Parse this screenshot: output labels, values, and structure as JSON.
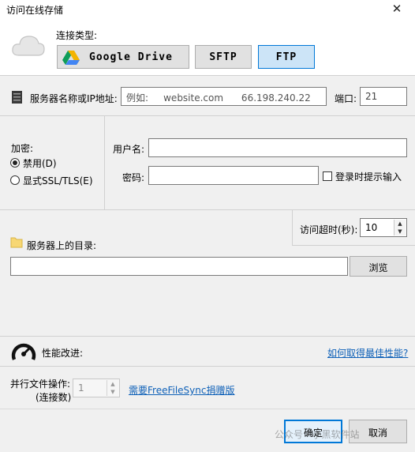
{
  "window": {
    "title": "访问在线存储",
    "close_glyph": "✕"
  },
  "connection": {
    "label": "连接类型:",
    "options": [
      {
        "label": "Google Drive",
        "selected": false
      },
      {
        "label": "SFTP",
        "selected": false
      },
      {
        "label": "FTP",
        "selected": true
      }
    ]
  },
  "server": {
    "label": "服务器名称或IP地址:",
    "placeholder": "例如:     website.com      66.198.240.22",
    "port_label": "端口:",
    "port_value": "21"
  },
  "encryption": {
    "label": "加密:",
    "options": [
      {
        "label": "禁用(D)",
        "selected": true
      },
      {
        "label": "显式SSL/TLS(E)",
        "selected": false
      }
    ]
  },
  "credentials": {
    "username_label": "用户名:",
    "username_value": "",
    "password_label": "密码:",
    "password_value": "",
    "prompt_label": "登录时提示输入",
    "prompt_checked": false
  },
  "timeout": {
    "label": "访问超时(秒):",
    "value": "10"
  },
  "directory": {
    "label": "服务器上的目录:",
    "value": "",
    "browse_label": "浏览"
  },
  "performance": {
    "label": "性能改进:",
    "link": "如何取得最佳性能?",
    "parallel_label": "并行文件操作:",
    "parallel_sub": "(连接数)",
    "parallel_value": "1",
    "donate_link": "需要FreeFileSync捐赠版"
  },
  "footer": {
    "ok_label": "确定",
    "cancel_label": "取消",
    "watermark": "公众号 · 小黑软件站"
  },
  "colors": {
    "accent": "#0078d7",
    "selected_bg": "#cce4f7",
    "link": "#0f61b8",
    "gdrive_green": "#0f9d58",
    "gdrive_yellow": "#f4b400",
    "gdrive_blue": "#4285f4"
  }
}
